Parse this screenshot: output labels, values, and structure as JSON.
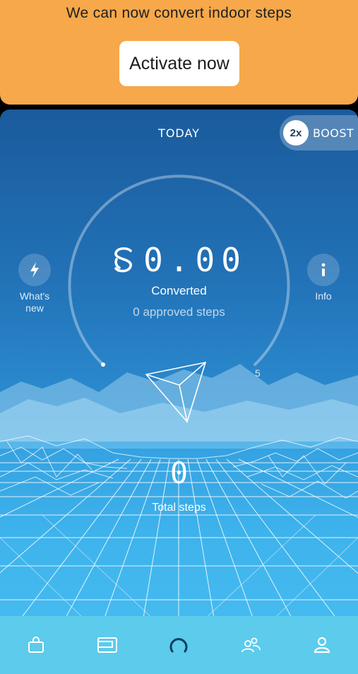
{
  "banner": {
    "message": "We can now convert indoor steps",
    "button_label": "Activate now"
  },
  "header": {
    "title": "TODAY",
    "boost_multiplier": "2x",
    "boost_label": "BOOST"
  },
  "side_buttons": {
    "whats_new_label": "What's new",
    "info_label": "Info"
  },
  "gauge": {
    "balance": "0.00",
    "converted_label": "Converted",
    "approved_steps": "0 approved steps",
    "max_label": "5",
    "progress": 0
  },
  "totals": {
    "steps_value": "0",
    "steps_label": "Total steps"
  },
  "bottom_nav": {
    "items": [
      "shop-icon",
      "wallet-icon",
      "sweatcoin-icon",
      "friends-icon",
      "profile-icon"
    ]
  },
  "colors": {
    "banner": "#f6a84a",
    "nav": "#5ccbec",
    "accent_white": "#ffffff"
  }
}
